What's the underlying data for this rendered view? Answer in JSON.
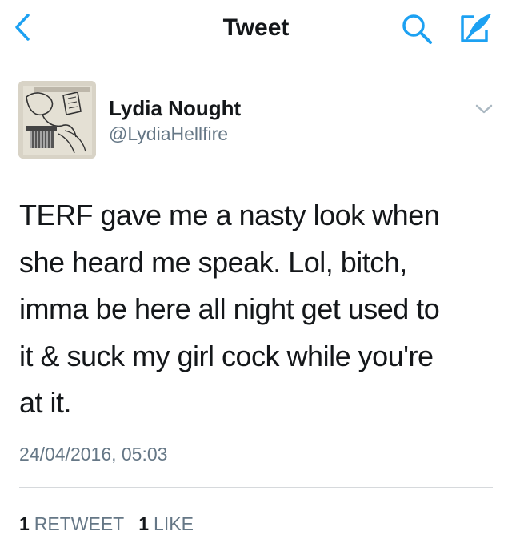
{
  "colors": {
    "accent": "#1da1f2",
    "text": "#14171a",
    "secondary": "#657786",
    "divider": "#d6d9dc"
  },
  "navbar": {
    "title": "Tweet",
    "back_icon": "chevron-left-icon",
    "search_icon": "search-icon",
    "compose_icon": "compose-icon"
  },
  "tweet": {
    "author": {
      "display_name": "Lydia Nought",
      "handle": "@LydiaHellfire"
    },
    "text_lines": [
      "TERF gave me a nasty look when",
      "she heard me speak. Lol, bitch,",
      "imma be here all night get used to",
      "it & suck my girl cock while you're",
      "at it."
    ],
    "timestamp": "24/04/2016, 05:03",
    "stats": {
      "retweets_count": "1",
      "retweets_label": "RETWEET",
      "likes_count": "1",
      "likes_label": "LIKE"
    }
  }
}
